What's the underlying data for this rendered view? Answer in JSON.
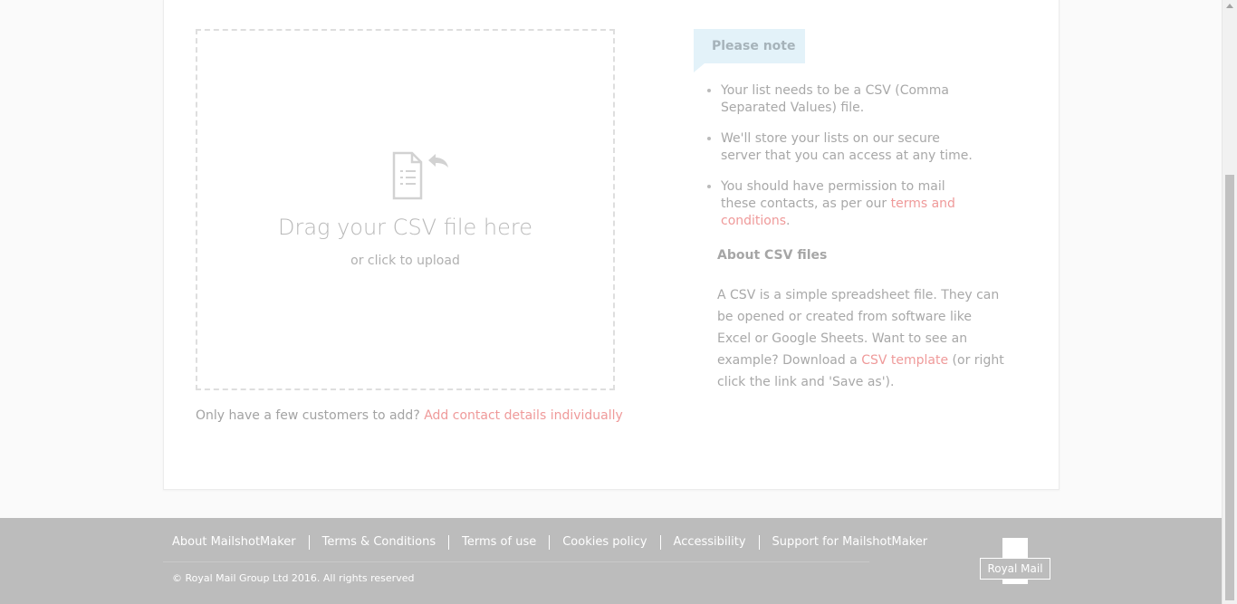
{
  "upload": {
    "title": "Drag your CSV file here",
    "subtitle": "or click to upload",
    "few_prefix": "Only have a few customers to add? ",
    "few_link": "Add contact details individually"
  },
  "note": {
    "tag": "Please note",
    "item1": "Your list needs to be a CSV (Comma Separated Values) file.",
    "item2": "We'll store your lists on our secure server that you can access at any time.",
    "item3_prefix": "You should have permission to mail these contacts, as per our ",
    "item3_link": "terms and conditions",
    "item3_suffix": "."
  },
  "about": {
    "title": "About CSV files",
    "text_prefix": "A CSV is a simple spreadsheet file. They can be opened or created from software like Excel or Google Sheets. Want to see an example? Download a ",
    "text_link": "CSV template",
    "text_suffix": " (or right click the link and 'Save as')."
  },
  "footer": {
    "links": [
      "About MailshotMaker",
      "Terms & Conditions",
      "Terms of use",
      "Cookies policy",
      "Accessibility",
      "Support for MailshotMaker"
    ],
    "copyright": "© Royal Mail Group Ltd 2016. All rights reserved",
    "logo_text": "Royal Mail"
  },
  "colors": {
    "link": "#ef9a9a",
    "note_bg": "#e3f2f9",
    "footer_bg": "#bcbcbc"
  }
}
